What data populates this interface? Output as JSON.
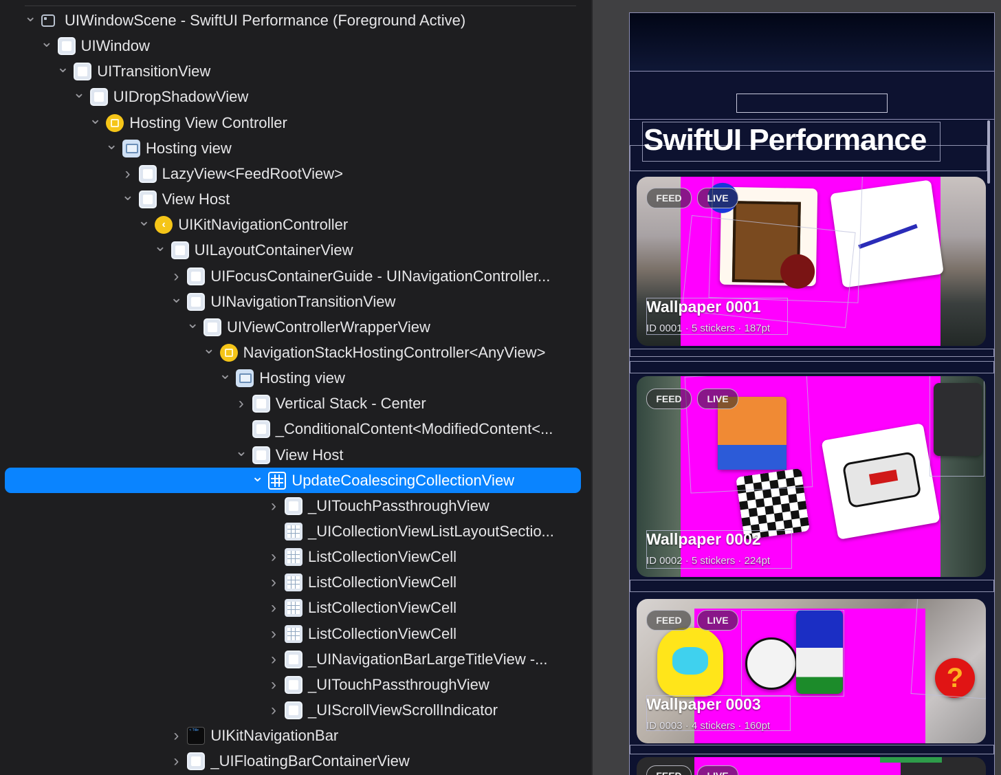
{
  "hierarchy": {
    "rows": [
      {
        "label": "UIWindowScene - SwiftUI Performance (Foreground Active)",
        "icon": "window-scene-icon",
        "chevron": "down"
      },
      {
        "label": "UIWindow",
        "icon": "view-icon",
        "chevron": "down"
      },
      {
        "label": "UITransitionView",
        "icon": "view-icon",
        "chevron": "down"
      },
      {
        "label": "UIDropShadowView",
        "icon": "view-icon",
        "chevron": "down"
      },
      {
        "label": "Hosting View Controller",
        "icon": "view-controller-icon",
        "chevron": "down"
      },
      {
        "label": "Hosting view",
        "icon": "hosting-view-icon",
        "chevron": "down"
      },
      {
        "label": "LazyView<FeedRootView>",
        "icon": "view-icon",
        "chevron": "right"
      },
      {
        "label": "View Host",
        "icon": "view-icon",
        "chevron": "down"
      },
      {
        "label": "UIKitNavigationController",
        "icon": "navigation-controller-icon",
        "chevron": "down"
      },
      {
        "label": "UILayoutContainerView",
        "icon": "view-icon",
        "chevron": "down"
      },
      {
        "label": "UIFocusContainerGuide - UINavigationController...",
        "icon": "view-icon",
        "chevron": "right"
      },
      {
        "label": "UINavigationTransitionView",
        "icon": "view-icon",
        "chevron": "down"
      },
      {
        "label": "UIViewControllerWrapperView",
        "icon": "view-icon",
        "chevron": "down"
      },
      {
        "label": "NavigationStackHostingController<AnyView>",
        "icon": "view-controller-icon",
        "chevron": "down"
      },
      {
        "label": "Hosting view",
        "icon": "hosting-view-icon",
        "chevron": "down"
      },
      {
        "label": "Vertical Stack - Center",
        "icon": "view-icon",
        "chevron": "right"
      },
      {
        "label": "_ConditionalContent<ModifiedContent<...",
        "icon": "view-icon",
        "chevron": "none"
      },
      {
        "label": "View Host",
        "icon": "view-icon",
        "chevron": "down"
      },
      {
        "label": "UpdateCoalescingCollectionView",
        "icon": "collection-view-icon",
        "chevron": "down",
        "selected": true
      },
      {
        "label": "_UITouchPassthroughView",
        "icon": "view-icon",
        "chevron": "right"
      },
      {
        "label": "_UICollectionViewListLayoutSectio...",
        "icon": "collection-view-icon",
        "chevron": "none"
      },
      {
        "label": "ListCollectionViewCell",
        "icon": "collection-view-icon",
        "chevron": "right"
      },
      {
        "label": "ListCollectionViewCell",
        "icon": "collection-view-icon",
        "chevron": "right"
      },
      {
        "label": "ListCollectionViewCell",
        "icon": "collection-view-icon",
        "chevron": "right"
      },
      {
        "label": "ListCollectionViewCell",
        "icon": "collection-view-icon",
        "chevron": "right"
      },
      {
        "label": "_UINavigationBarLargeTitleView -...",
        "icon": "view-icon",
        "chevron": "right"
      },
      {
        "label": "_UITouchPassthroughView",
        "icon": "view-icon",
        "chevron": "right"
      },
      {
        "label": "_UIScrollViewScrollIndicator",
        "icon": "view-icon",
        "chevron": "right"
      },
      {
        "label": "UIKitNavigationBar",
        "icon": "navigation-bar-icon",
        "chevron": "right"
      },
      {
        "label": "_UIFloatingBarContainerView",
        "icon": "view-icon",
        "chevron": "right"
      }
    ]
  },
  "preview": {
    "large_title": "SwiftUI Performance",
    "cards": [
      {
        "badge_feed": "FEED",
        "badge_live": "LIVE",
        "title": "Wallpaper 0001",
        "subtitle": "ID 0001 · 5 stickers · 187pt"
      },
      {
        "badge_feed": "FEED",
        "badge_live": "LIVE",
        "title": "Wallpaper 0002",
        "subtitle": "ID 0002 · 5 stickers · 224pt"
      },
      {
        "badge_feed": "FEED",
        "badge_live": "LIVE",
        "title": "Wallpaper 0003",
        "subtitle": "ID 0003 · 4 stickers · 160pt"
      },
      {
        "badge_feed": "FEED",
        "badge_live": "LIVE",
        "title": "",
        "subtitle": ""
      }
    ]
  },
  "colors": {
    "selection": "#0a84ff",
    "debug_pink": "#ff00ff",
    "panel_bg": "#1e1e20"
  }
}
